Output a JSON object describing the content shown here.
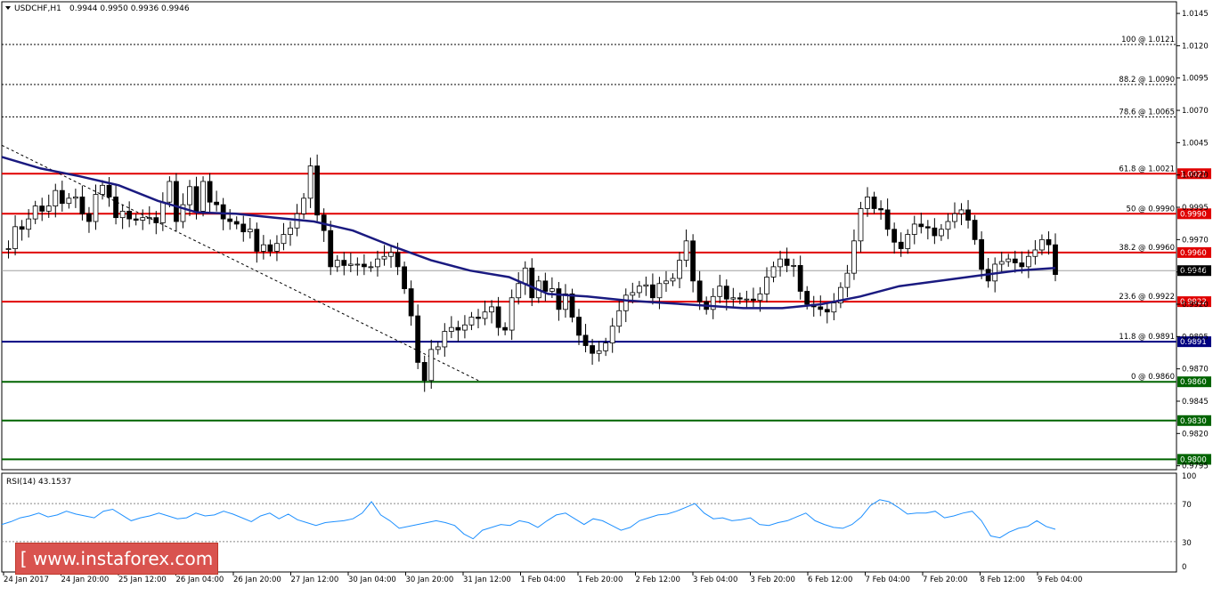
{
  "header": {
    "symbol_label": "USDCHF,H1",
    "ohlc_text": "0.9944 0.9950 0.9936 0.9946",
    "rsi_label": "RSI(14) 43.1537"
  },
  "logo": {
    "text": "[ www.instaforex.com ]"
  },
  "colors": {
    "resistance": "#e00000",
    "ma": "#1a1a80",
    "support_blue": "#000080",
    "support_green": "#006400",
    "rsi": "#1e90ff",
    "candle": "#007000"
  },
  "chart_data": [
    {
      "type": "candlestick",
      "instrument": "USDCHF",
      "timeframe": "H1",
      "ohlc_last": {
        "open": 0.9944,
        "high": 0.995,
        "low": 0.9936,
        "close": 0.9946
      },
      "ylim": [
        0.9792,
        1.0154
      ],
      "y_ticks": [
        "1.0145",
        "1.0120",
        "1.0095",
        "1.0070",
        "1.0045",
        "1.0020",
        "0.9995",
        "0.9970",
        "0.9945",
        "0.9920",
        "0.9895",
        "0.9870",
        "0.9845",
        "0.9820",
        "0.9795"
      ],
      "x_ticks": [
        "24 Jan 2017",
        "24 Jan 20:00",
        "25 Jan 12:00",
        "26 Jan 04:00",
        "26 Jan 20:00",
        "27 Jan 12:00",
        "30 Jan 04:00",
        "30 Jan 20:00",
        "31 Jan 12:00",
        "1 Feb 04:00",
        "1 Feb 20:00",
        "2 Feb 12:00",
        "3 Feb 04:00",
        "3 Feb 20:00",
        "6 Feb 12:00",
        "7 Feb 04:00",
        "7 Feb 20:00",
        "8 Feb 12:00",
        "9 Feb 04:00"
      ],
      "fibonacci_levels": [
        {
          "label": "100 @ 1.0121",
          "value": 1.0121,
          "style": "dashed"
        },
        {
          "label": "88.2 @ 1.0090",
          "value": 1.009,
          "style": "dashed"
        },
        {
          "label": "78.6 @ 1.0065",
          "value": 1.0065,
          "style": "dashed"
        },
        {
          "label": "61.8 @ 1.0021",
          "value": 1.0021,
          "style": "solid",
          "color": "#e00000",
          "badge": "1.0021"
        },
        {
          "label": "50 @ 0.9990",
          "value": 0.999,
          "style": "solid",
          "color": "#e00000",
          "badge": "0.9990"
        },
        {
          "label": "38.2 @ 0.9960",
          "value": 0.996,
          "style": "solid",
          "color": "#e00000",
          "badge": "0.9960"
        },
        {
          "label": "23.6 @ 0.9922",
          "value": 0.9922,
          "style": "solid",
          "color": "#e00000",
          "badge": "0.9922"
        },
        {
          "label": "11.8 @ 0.9891",
          "value": 0.9891,
          "style": "solid",
          "color": "#000080",
          "badge": "0.9891"
        },
        {
          "label": "0 @ 0.9860",
          "value": 0.986,
          "style": "solid",
          "color": "#006400",
          "badge": "0.9860"
        }
      ],
      "extra_levels": [
        {
          "value": 0.983,
          "color": "#006400",
          "badge": "0.9830"
        },
        {
          "value": 0.98,
          "color": "#006400",
          "badge": "0.9800"
        }
      ],
      "current_price": {
        "value": 0.9946,
        "badge": "0.9946"
      },
      "price_path": [
        [
          0.9963,
          0.9963,
          0.998,
          0.9978,
          0.9986,
          0.9996,
          0.9992,
          0.9996,
          1.0008,
          0.9998,
          1.0002,
          1.0003,
          0.999,
          0.9984,
          1.0005,
          1.0012,
          1.0003,
          0.9987,
          0.9992,
          0.9986,
          0.9985,
          0.9987,
          0.9987,
          0.9983,
          0.9999,
          1.0015,
          0.9984,
          0.9997,
          1.0011,
          0.9992,
          1.0015,
          0.9999,
          0.9997,
          0.9986,
          0.9984,
          0.9982,
          0.9976,
          0.9978,
          0.9961,
          0.9966,
          0.9961,
          0.9967,
          0.9974,
          0.9979,
          0.999,
          1.0002,
          1.0027,
          0.9989,
          0.9977,
          0.9949,
          0.9954,
          0.995,
          0.9951,
          0.9951,
          0.9949,
          0.9949,
          0.9955,
          0.9957,
          0.996,
          0.9949,
          0.9932,
          0.9911,
          0.9875,
          0.9861,
          0.9885,
          0.9887,
          0.9899,
          0.9902,
          0.99,
          0.9904,
          0.991,
          0.9909,
          0.9914,
          0.9918,
          0.9902,
          0.99,
          0.9925,
          0.9936,
          0.9948,
          0.9925,
          0.9938,
          0.993,
          0.9932,
          0.9916,
          0.9928,
          0.991,
          0.9896,
          0.9888,
          0.9882,
          0.9884,
          0.989,
          0.9903,
          0.9915,
          0.9927,
          0.9929,
          0.9934,
          0.9935,
          0.9925,
          0.9936,
          0.9938,
          0.994,
          0.9954,
          0.9969,
          0.9938,
          0.9922,
          0.9916,
          0.9926,
          0.9934,
          0.9924,
          0.9925,
          0.9924,
          0.9924,
          0.9923,
          0.9928,
          0.9941,
          0.9949,
          0.9955,
          0.995,
          0.995,
          0.993,
          0.992,
          0.9918,
          0.9916,
          0.9914,
          0.9921,
          0.9933,
          0.9944,
          0.9969,
          0.9994,
          1.0003,
          0.9994,
          0.9993,
          0.9978,
          0.9968,
          0.9963,
          0.9974,
          0.9982,
          0.998,
          0.9979,
          0.9973,
          0.9978,
          0.9984,
          0.999,
          0.9993,
          0.9985,
          0.997,
          0.9947,
          0.9938,
          0.9951,
          0.9953,
          0.9955,
          0.9952,
          0.9949,
          0.9957,
          0.9962,
          0.997,
          0.9966,
          0.9943
        ]
      ],
      "moving_average_path": [
        1.0034,
        1.0025,
        1.0019,
        1.0012,
        1.0,
        0.9991,
        0.999,
        0.9987,
        0.9984,
        0.9977,
        0.9965,
        0.9954,
        0.9946,
        0.9941,
        0.9928,
        0.9926,
        0.9923,
        0.9921,
        0.9919,
        0.9917,
        0.9917,
        0.992,
        0.9926,
        0.9934,
        0.9938,
        0.9942,
        0.9946,
        0.9948
      ],
      "rsi": {
        "label": "RSI(14) 43.1537",
        "value": 43.1537,
        "ylim": [
          0,
          100
        ],
        "y_ticks": [
          "100",
          "70",
          "30",
          "0"
        ],
        "levels": [
          70,
          30
        ],
        "values": [
          48,
          51,
          55,
          57,
          60,
          56,
          58,
          62,
          59,
          57,
          55,
          62,
          64,
          58,
          52,
          55,
          57,
          60,
          57,
          54,
          55,
          60,
          57,
          58,
          62,
          59,
          55,
          51,
          57,
          60,
          54,
          59,
          53,
          50,
          47,
          50,
          51,
          52,
          54,
          60,
          72,
          58,
          52,
          44,
          46,
          48,
          50,
          52,
          50,
          47,
          38,
          33,
          42,
          45,
          48,
          47,
          52,
          50,
          45,
          52,
          58,
          60,
          54,
          48,
          54,
          52,
          47,
          42,
          45,
          52,
          55,
          58,
          59,
          62,
          66,
          70,
          60,
          54,
          55,
          52,
          53,
          55,
          48,
          47,
          50,
          52,
          56,
          60,
          52,
          48,
          45,
          44,
          48,
          56,
          68,
          74,
          72,
          66,
          59,
          60,
          60,
          62,
          55,
          57,
          60,
          62,
          52,
          36,
          34,
          40,
          44,
          46,
          52,
          46,
          43
        ]
      }
    }
  ]
}
